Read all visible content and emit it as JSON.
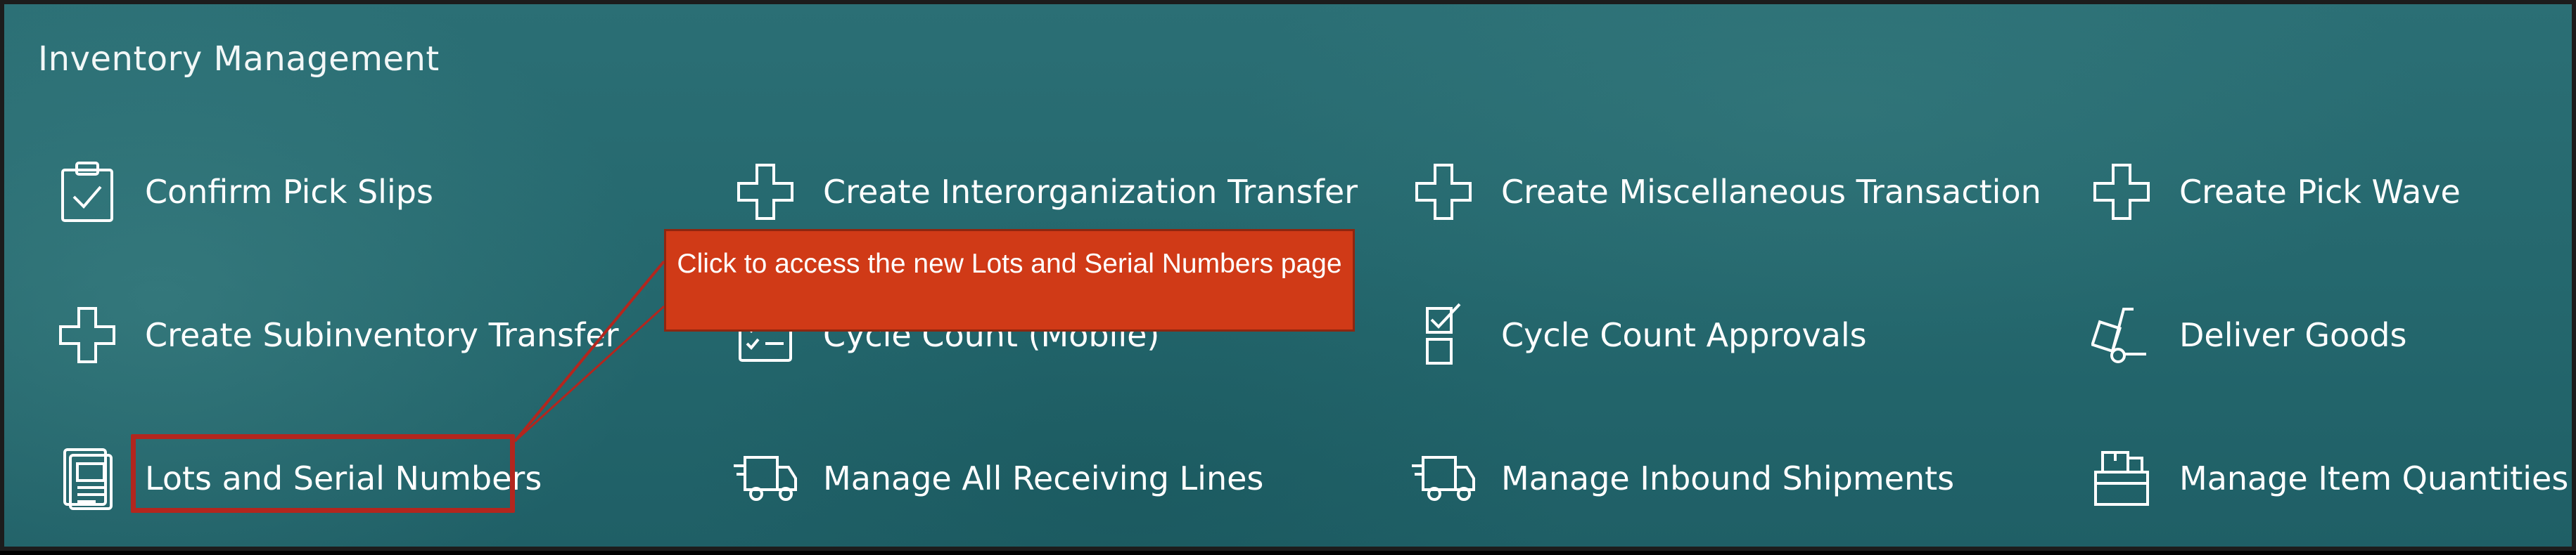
{
  "page": {
    "title": "Inventory Management"
  },
  "tiles": [
    {
      "label": "Confirm Pick Slips",
      "icon": "clipboard-check-icon"
    },
    {
      "label": "Create Interorganization Transfer",
      "icon": "plus-icon"
    },
    {
      "label": "Create Miscellaneous Transaction",
      "icon": "plus-icon"
    },
    {
      "label": "Create Pick Wave",
      "icon": "plus-icon"
    },
    {
      "label": "Create Subinventory Transfer",
      "icon": "plus-icon"
    },
    {
      "label": "Cycle Count (Mobile)",
      "icon": "checklist-icon"
    },
    {
      "label": "Cycle Count Approvals",
      "icon": "checkbox-stack-icon"
    },
    {
      "label": "Deliver Goods",
      "icon": "hand-truck-icon"
    },
    {
      "label": "Lots and Serial Numbers",
      "icon": "serial-document-icon"
    },
    {
      "label": "Manage All Receiving Lines",
      "icon": "delivery-truck-icon"
    },
    {
      "label": "Manage Inbound Shipments",
      "icon": "delivery-truck-icon"
    },
    {
      "label": "Manage Item Quantities",
      "icon": "package-box-icon"
    }
  ],
  "callout": {
    "text": "Click to access the new Lots and Serial Numbers page"
  },
  "colors": {
    "background": "#26686e",
    "callout": "#d03a17",
    "highlight": "#b3261e",
    "text": "#ffffff"
  }
}
